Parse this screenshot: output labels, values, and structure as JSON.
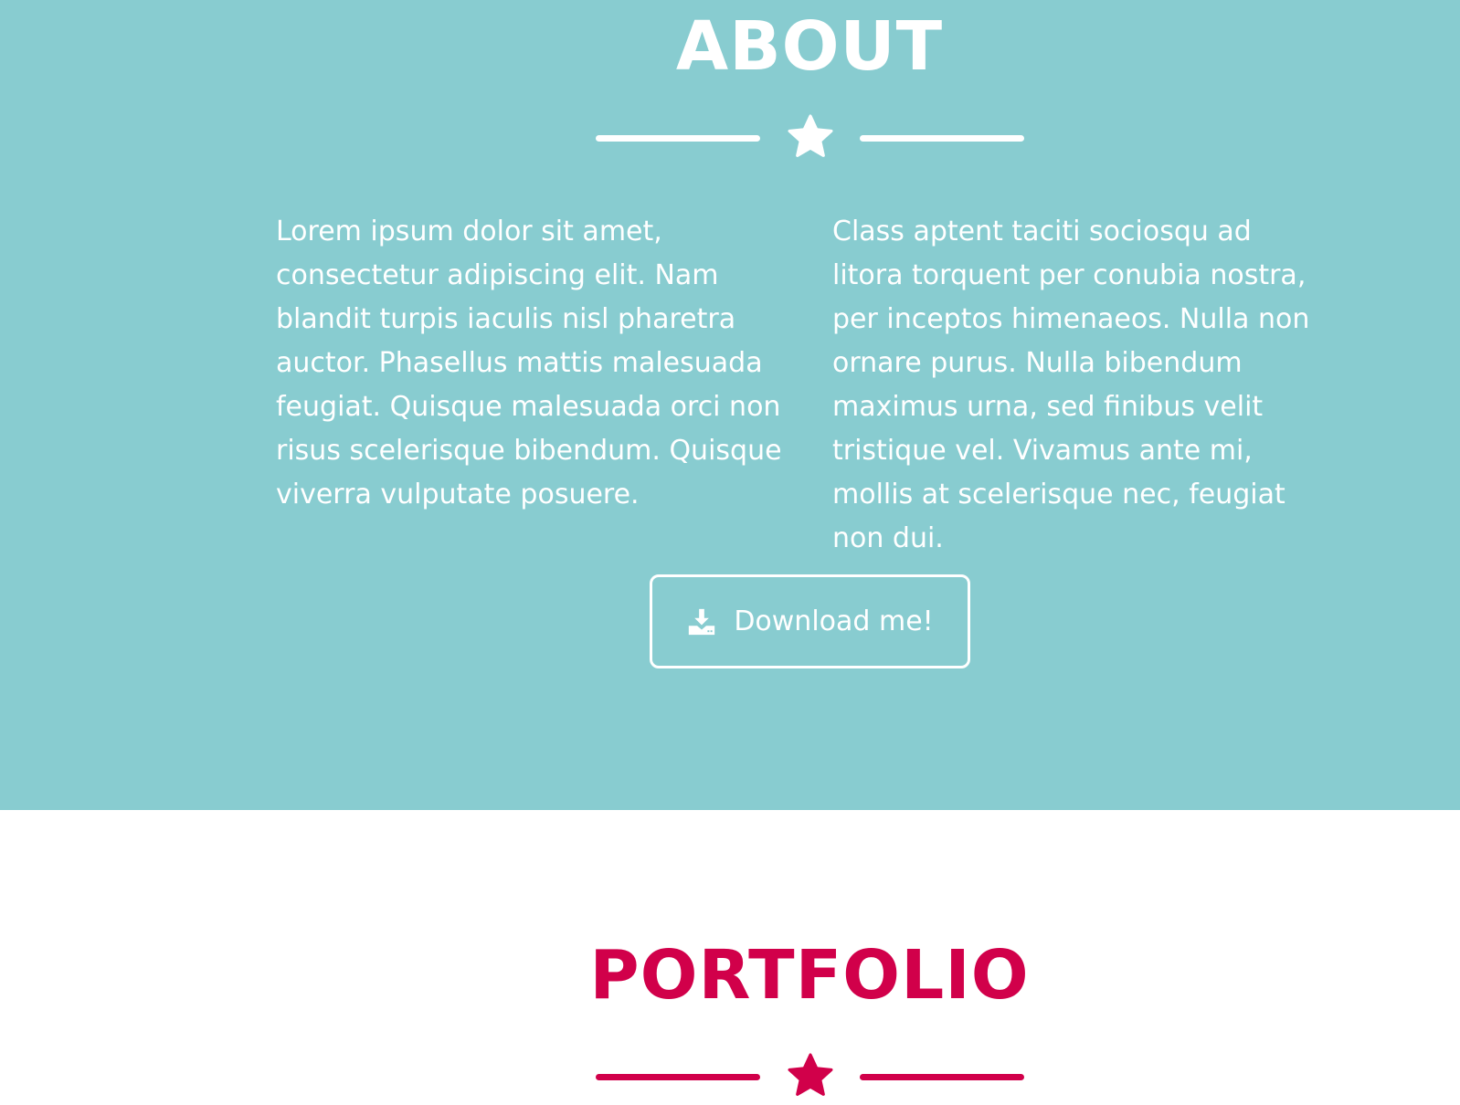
{
  "about": {
    "title": "ABOUT",
    "column_left": "Lorem ipsum dolor sit amet, consectetur adipiscing elit. Nam blandit turpis iaculis nisl pharetra auctor. Phasellus mattis malesuada feugiat. Quisque malesuada orci non risus scelerisque bibendum. Quisque viverra vulputate posuere.",
    "column_right": "Class aptent taciti sociosqu ad litora torquent per conubia nostra, per inceptos himenaeos. Nulla non ornare purus. Nulla bibendum maximus urna, sed finibus velit tristique vel. Vivamus ante mi, mollis at scelerisque nec, feugiat non dui.",
    "download_label": "Download me!",
    "download_icon": "download-icon",
    "divider_icon": "star-icon",
    "background": "#88CCD0",
    "text_color": "#FFFFFF"
  },
  "portfolio": {
    "title": "PORTFOLIO",
    "divider_icon": "star-icon",
    "accent": "#D1004A",
    "background": "#FFFFFF"
  }
}
